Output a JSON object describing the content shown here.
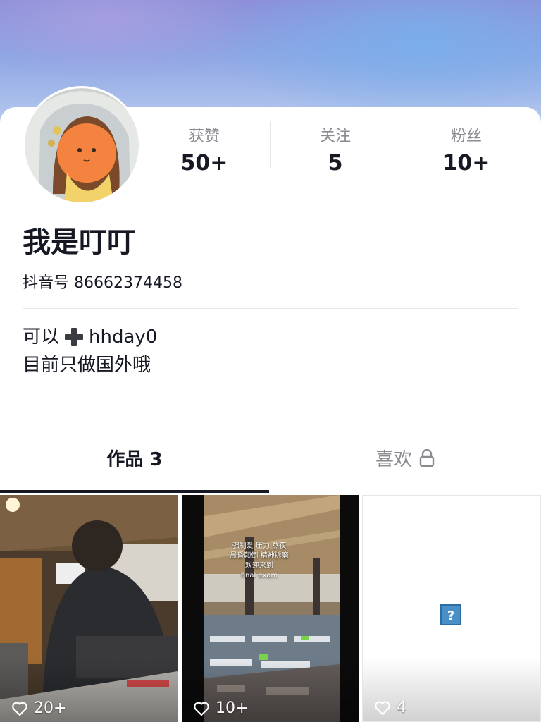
{
  "profile": {
    "nickname": "我是叮叮",
    "douyin_id": "抖音号 86662374458",
    "bio_line1_prefix": "可以",
    "bio_line1_suffix": "hhday0",
    "bio_line2": "目前只做国外哦",
    "avatar_icon": "avatar-image"
  },
  "stats": [
    {
      "label": "获赞",
      "value": "50+"
    },
    {
      "label": "关注",
      "value": "5"
    },
    {
      "label": "粉丝",
      "value": "10+"
    }
  ],
  "tabs": {
    "works_label": "作品 3",
    "likes_label": "喜欢",
    "likes_icon": "lock-icon"
  },
  "videos": [
    {
      "likes": "20+"
    },
    {
      "likes": "10+",
      "overlay": [
        "强制爱 压力 熬夜",
        "晨昏颠倒 精神拆磨",
        "欢迎来到",
        "final exam"
      ]
    },
    {
      "likes": "4"
    }
  ],
  "colors": {
    "text_primary": "#161823",
    "text_secondary": "#8a8b91",
    "banner_top": "#8d8fd8",
    "banner_bottom": "#b6c9ee"
  }
}
